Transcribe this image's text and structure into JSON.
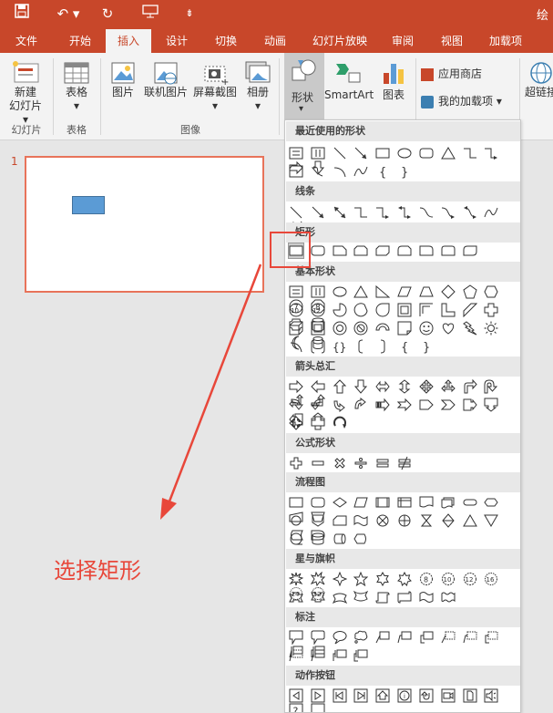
{
  "tabs": [
    "文件",
    "开始",
    "插入",
    "设计",
    "切换",
    "动画",
    "幻灯片放映",
    "审阅",
    "视图",
    "加载项"
  ],
  "active_tab": "插入",
  "title_partial": "绘",
  "ribbon": {
    "new_slide": "新建\n幻灯片",
    "new_slide_l1": "新建",
    "new_slide_l2": "幻灯片",
    "table": "表格",
    "picture": "图片",
    "online_picture": "联机图片",
    "screenshot": "屏幕截图",
    "album": "相册",
    "shapes": "形状",
    "smartart": "SmartArt",
    "chart": "图表",
    "store": "应用商店",
    "my_addins": "我的加载项",
    "hyperlink": "超链接",
    "groups": {
      "slides": "幻灯片",
      "tables": "表格",
      "images": "图像"
    }
  },
  "slide_number": "1",
  "caption": "选择矩形",
  "dropdown": {
    "sections": [
      "最近使用的形状",
      "线条",
      "矩形",
      "基本形状",
      "箭头总汇",
      "公式形状",
      "流程图",
      "星与旗帜",
      "标注",
      "动作按钮"
    ]
  },
  "colors": {
    "accent": "#c8472a",
    "highlight": "#e8473a",
    "shape_fill": "#5b9bd5"
  }
}
